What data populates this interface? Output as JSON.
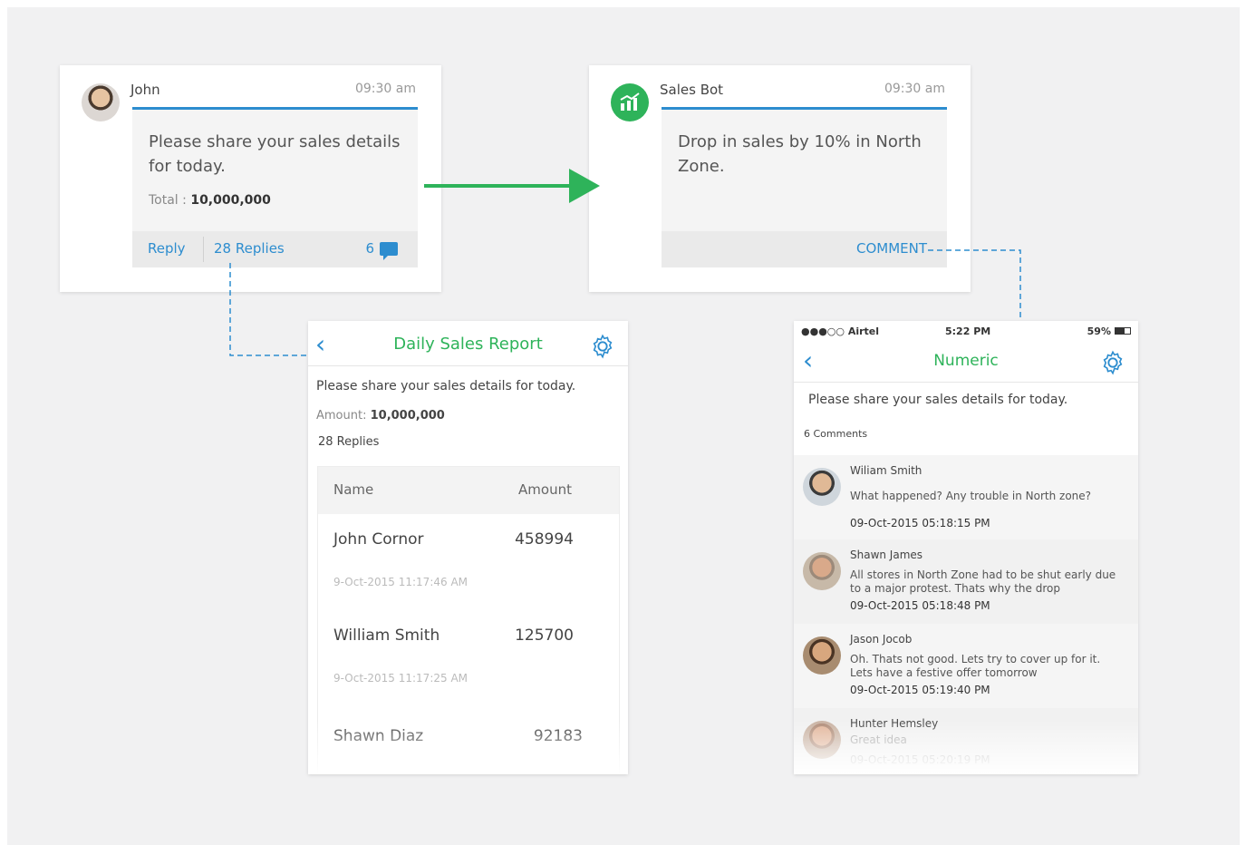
{
  "john_card": {
    "sender": "John",
    "time": "09:30 am",
    "message": "Please share your sales details for today.",
    "total_label": "Total :",
    "total_value": "10,000,000",
    "reply_label": "Reply",
    "replies_label": "28 Replies",
    "comment_count": "6"
  },
  "bot_card": {
    "sender": "Sales Bot",
    "time": "09:30 am",
    "message": "Drop in sales by 10% in North Zone.",
    "comment_label": "COMMENT"
  },
  "report_screen": {
    "title": "Daily Sales Report",
    "prompt": "Please share your sales details for today.",
    "amount_label": "Amount:",
    "amount_value": "10,000,000",
    "replies": "28 Replies",
    "col_name": "Name",
    "col_amount": "Amount",
    "rows": [
      {
        "name": "John Cornor",
        "date": "9-Oct-2015 11:17:46 AM",
        "amount": "458994"
      },
      {
        "name": "William Smith",
        "date": "9-Oct-2015 11:17:25 AM",
        "amount": "125700"
      },
      {
        "name": "Shawn Diaz",
        "date": "",
        "amount": "92183"
      }
    ]
  },
  "numeric_screen": {
    "carrier": "●●●○○ Airtel",
    "clock": "5:22 PM",
    "battery": "59%",
    "title": "Numeric",
    "prompt": "Please share your sales details for today.",
    "comments_count": "6 Comments",
    "comments": [
      {
        "name": "Wiliam Smith",
        "text": "What happened? Any trouble in North zone?",
        "date": "09-Oct-2015 05:18:15 PM"
      },
      {
        "name": "Shawn James",
        "text": "All stores in North Zone had to be shut early due to a major protest. Thats why the drop",
        "date": "09-Oct-2015 05:18:48 PM"
      },
      {
        "name": "Jason Jocob",
        "text": "Oh. Thats not good. Lets try to cover up for it. Lets have a festive offer tomorrow",
        "date": "09-Oct-2015 05:19:40 PM"
      },
      {
        "name": "Hunter Hemsley",
        "text": "Great idea",
        "date": "09-Oct-2015 05:20:19 PM"
      }
    ]
  },
  "colors": {
    "accent_blue": "#2d8dcf",
    "accent_green": "#2eb35a",
    "arrow_green": "#2eb35a"
  }
}
